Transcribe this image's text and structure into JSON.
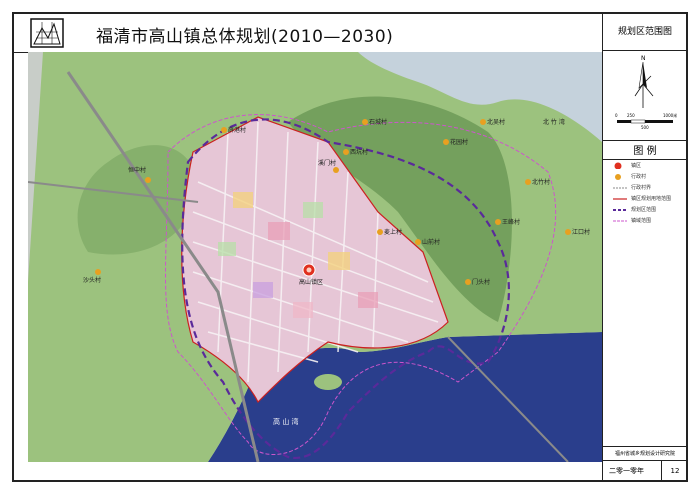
{
  "header": {
    "title": "福清市高山镇总体规划(2010—2030)"
  },
  "sidebar": {
    "drawing_title": "规划区范围图",
    "scale_labels": [
      "0",
      "250",
      "500",
      "1000米"
    ],
    "legend_title": "图  例",
    "legend_items": [
      {
        "label": "镇区",
        "icon": "town-center-icon",
        "color": "#e03020"
      },
      {
        "label": "行政村",
        "icon": "village-icon",
        "color": "#e8a020"
      },
      {
        "label": "行政村界",
        "icon": "village-boundary-icon",
        "color": "#888888"
      },
      {
        "label": "镇区规划用地范围",
        "icon": "planning-land-boundary-icon",
        "color": "#cc2020"
      },
      {
        "label": "规划区范围",
        "icon": "planning-area-boundary-icon",
        "color": "#5a2a9a"
      },
      {
        "label": "镇域范围",
        "icon": "township-boundary-icon",
        "color": "#cc55cc"
      }
    ],
    "organization": "福州省城乡规划设计研究院",
    "date": "二零一零年",
    "page_number": "12"
  },
  "map": {
    "town_label": "高山镇区",
    "bay_label": "高  山  湾",
    "north_sea_label": "北 竹 湾",
    "villages": [
      "薛港村",
      "恒中村",
      "石城村",
      "西坑村",
      "溪门村",
      "花园村",
      "北吴村",
      "北竹村",
      "江口村",
      "王峰村",
      "麦上村",
      "山前村",
      "门头村",
      "沙头村"
    ]
  }
}
